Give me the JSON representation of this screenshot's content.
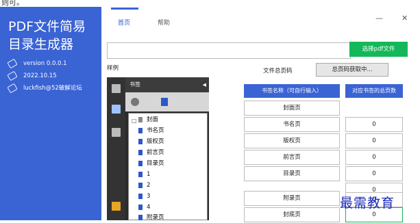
{
  "top_text": "则可。",
  "sidebar": {
    "title_line1": "PDF文件简易",
    "title_line2": "目录生成器",
    "version": "version  0.0.0.1",
    "date": "2022.10.15",
    "author": "luckfish@52破解论坛"
  },
  "tabs": [
    {
      "label": "首页"
    },
    {
      "label": "帮助"
    }
  ],
  "window": {
    "minimize": "—",
    "close": "✕"
  },
  "path_input": {
    "value": "",
    "placeholder": ""
  },
  "choose_button": "选择pdf文件",
  "sample_label": "样例",
  "total_pages": {
    "label": "文件总页码",
    "button": "总页码获取中..."
  },
  "sample_panel": {
    "header": "书签",
    "collapse": "◀",
    "items": [
      "封面",
      "书名页",
      "版权页",
      "前言页",
      "目录页",
      "1",
      "2",
      "3",
      "4",
      "附录页"
    ]
  },
  "table": {
    "headers": [
      "书签名称（可自行输入）",
      "对应书签的总页数"
    ],
    "rows": [
      {
        "name": "封面页",
        "pages": "0"
      },
      {
        "name": "书名页",
        "pages": "0"
      },
      {
        "name": "版权页",
        "pages": "0"
      },
      {
        "name": "前言页",
        "pages": "0"
      },
      {
        "name": "目录页",
        "pages": "0"
      },
      {
        "name": "附录页",
        "pages": "0"
      },
      {
        "name": "封底页",
        "pages": "0"
      }
    ]
  },
  "watermark": "最需教育"
}
